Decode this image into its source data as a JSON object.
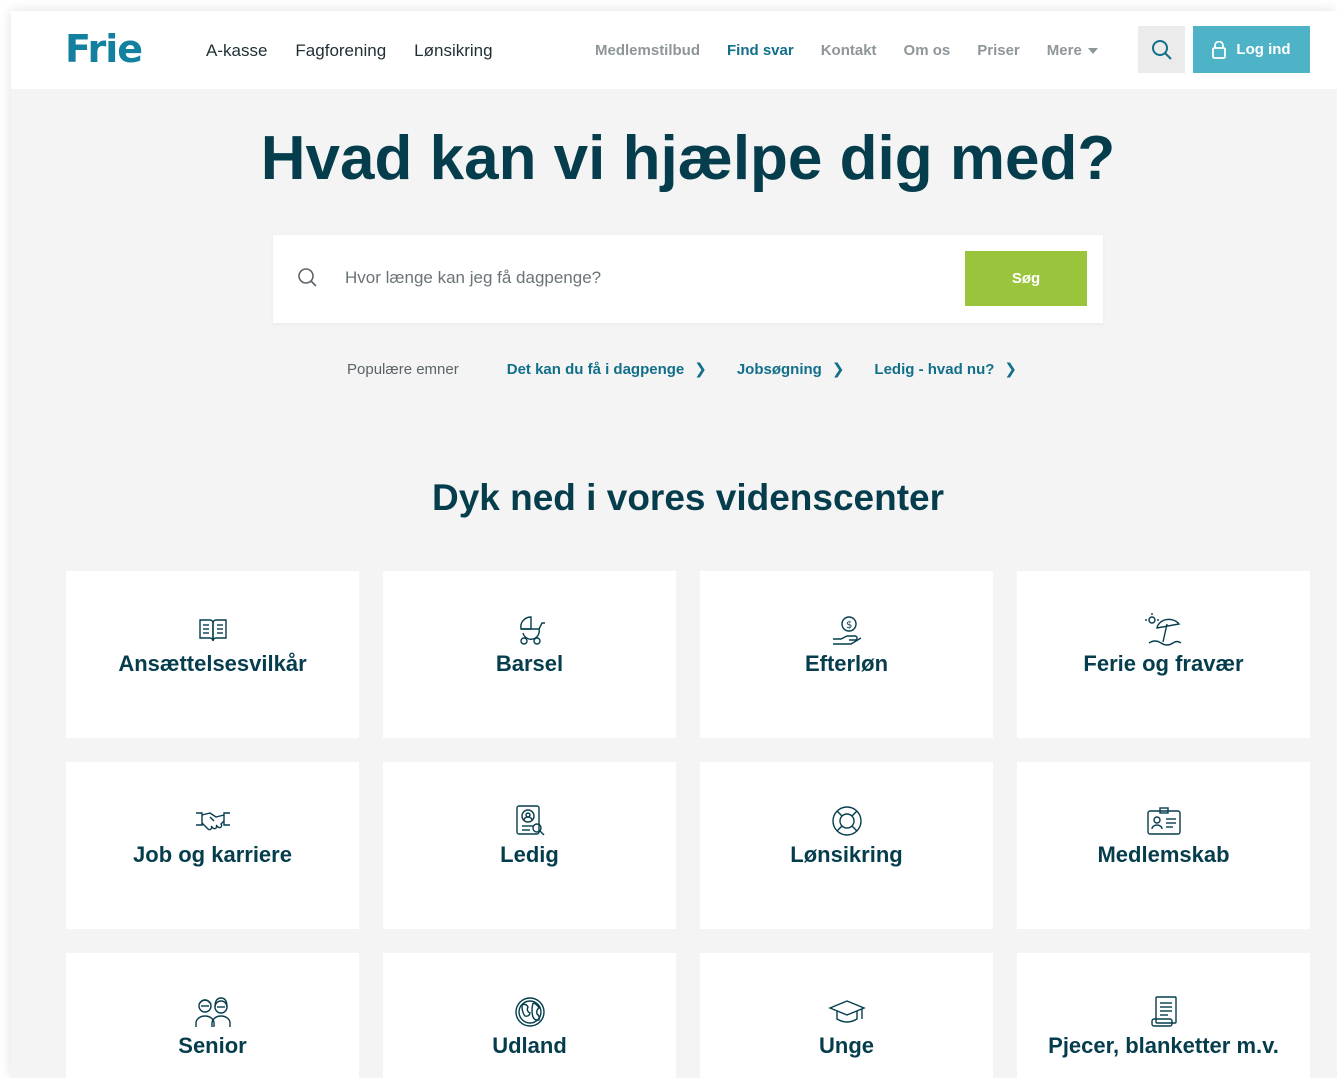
{
  "header": {
    "logo": "Frie",
    "main_nav": [
      "A-kasse",
      "Fagforening",
      "Lønsikring"
    ],
    "secondary_nav": [
      "Medlemstilbud",
      "Find svar",
      "Kontakt",
      "Om os",
      "Priser",
      "Mere"
    ],
    "active_item": "Find svar",
    "login_label": "Log ind"
  },
  "hero": {
    "title": "Hvad kan vi hjælpe dig med?",
    "search_placeholder": "Hvor længe kan jeg få dagpenge?",
    "search_button": "Søg"
  },
  "popular": {
    "label": "Populære emner",
    "links": [
      "Det kan du få i dagpenge",
      "Jobsøgning",
      "Ledig - hvad nu?"
    ]
  },
  "knowledge": {
    "title": "Dyk ned i vores videnscenter",
    "cards": [
      {
        "label": "Ansættelsesvilkår",
        "icon": "book-icon"
      },
      {
        "label": "Barsel",
        "icon": "stroller-icon"
      },
      {
        "label": "Efterløn",
        "icon": "money-hand-icon"
      },
      {
        "label": "Ferie og fravær",
        "icon": "beach-umbrella-icon"
      },
      {
        "label": "Job og karriere",
        "icon": "handshake-icon"
      },
      {
        "label": "Ledig",
        "icon": "id-search-icon"
      },
      {
        "label": "Lønsikring",
        "icon": "lifebuoy-icon"
      },
      {
        "label": "Medlemskab",
        "icon": "member-card-icon"
      },
      {
        "label": "Senior",
        "icon": "seniors-icon"
      },
      {
        "label": "Udland",
        "icon": "globe-icon"
      },
      {
        "label": "Unge",
        "icon": "graduation-cap-icon"
      },
      {
        "label": "Pjecer, blanketter m.v.",
        "icon": "document-icon"
      }
    ]
  },
  "colors": {
    "brand": "#1380a0",
    "heading": "#053d4d",
    "login_button": "#4fb3c7",
    "search_button": "#9bc43d",
    "background": "#f4f4f4"
  }
}
